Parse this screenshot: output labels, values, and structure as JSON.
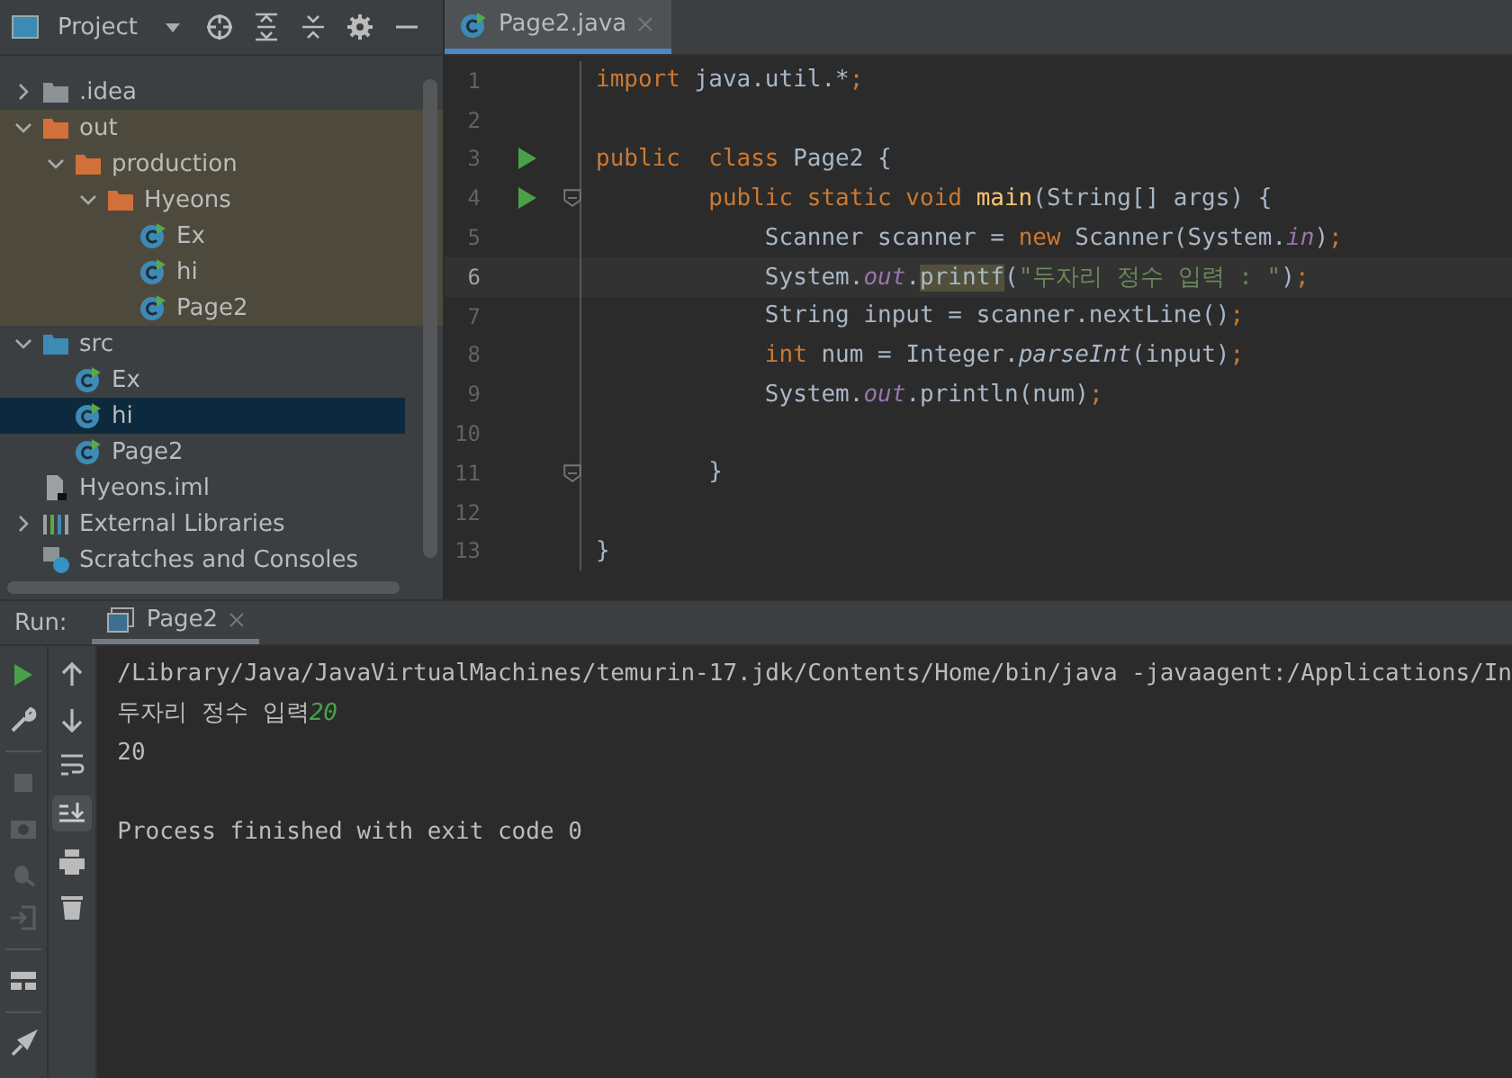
{
  "project_toolbar": {
    "title": "Project"
  },
  "tree": [
    {
      "label": ".idea",
      "kind": "folder",
      "expanded": false,
      "selected": false,
      "excluded": false
    },
    {
      "label": "out",
      "kind": "folder",
      "expanded": true,
      "selected": false,
      "excluded": true,
      "children": [
        {
          "label": "production",
          "kind": "folder",
          "expanded": true,
          "selected": false,
          "children": [
            {
              "label": "Hyeons",
              "kind": "folder",
              "expanded": true,
              "selected": false,
              "children": [
                {
                  "label": "Ex",
                  "kind": "class",
                  "selected": false
                },
                {
                  "label": "hi",
                  "kind": "class",
                  "selected": false
                },
                {
                  "label": "Page2",
                  "kind": "class",
                  "selected": false
                }
              ]
            }
          ]
        }
      ]
    },
    {
      "label": "src",
      "kind": "source",
      "expanded": true,
      "selected": false,
      "excluded": false,
      "children": [
        {
          "label": "Ex",
          "kind": "class",
          "selected": false
        },
        {
          "label": "hi",
          "kind": "class",
          "selected": true
        },
        {
          "label": "Page2",
          "kind": "class",
          "selected": false
        }
      ]
    },
    {
      "label": "Hyeons.iml",
      "kind": "file",
      "selected": false,
      "excluded": false
    },
    {
      "label": "External Libraries",
      "kind": "library",
      "expanded": false,
      "selected": false,
      "excluded": false
    },
    {
      "label": "Scratches and Consoles",
      "kind": "scratch",
      "selected": false,
      "excluded": false
    }
  ],
  "editor_tabs": [
    {
      "label": "Page2.java",
      "selected": true
    }
  ],
  "code": [
    {
      "number": "1",
      "run": false,
      "fold": false,
      "current": false,
      "tokens": [
        {
          "kind": "keyword",
          "text": "import"
        },
        {
          "kind": "plain",
          "text": " java.util.*"
        },
        {
          "kind": "keyword",
          "text": ";"
        }
      ]
    },
    {
      "number": "2",
      "run": false,
      "fold": false,
      "current": false
    },
    {
      "number": "3",
      "run": true,
      "fold": false,
      "current": false,
      "tokens": [
        {
          "kind": "keyword",
          "text": "public  class"
        },
        {
          "kind": "plain",
          "text": " Page2 {"
        }
      ]
    },
    {
      "number": "4",
      "run": true,
      "fold": true,
      "current": false,
      "tokens": [
        {
          "kind": "keyword",
          "text": "        public static void"
        },
        {
          "kind": "method",
          "text": " main"
        },
        {
          "kind": "plain",
          "text": "(String[] args) {"
        }
      ]
    },
    {
      "number": "5",
      "run": false,
      "fold": false,
      "current": false,
      "tokens": [
        {
          "kind": "plain",
          "text": "            Scanner scanner = "
        },
        {
          "kind": "keyword",
          "text": "new"
        },
        {
          "kind": "plain",
          "text": " Scanner(System."
        },
        {
          "kind": "field",
          "text": "in"
        },
        {
          "kind": "plain",
          "text": ")"
        },
        {
          "kind": "keyword",
          "text": ";"
        }
      ]
    },
    {
      "number": "6",
      "run": false,
      "fold": false,
      "current": true,
      "tokens": [
        {
          "kind": "plain",
          "text": "            System."
        },
        {
          "kind": "field",
          "text": "out"
        },
        {
          "kind": "plain",
          "text": "."
        },
        {
          "kind": "highlight",
          "text": "printf"
        },
        {
          "kind": "plain",
          "text": "("
        },
        {
          "kind": "string",
          "text": "\"두자리 정수 입력 : \""
        },
        {
          "kind": "plain",
          "text": ")"
        },
        {
          "kind": "keyword",
          "text": ";"
        }
      ]
    },
    {
      "number": "7",
      "run": false,
      "fold": false,
      "current": false,
      "tokens": [
        {
          "kind": "plain",
          "text": "            String input = scanner.nextLine()"
        },
        {
          "kind": "keyword",
          "text": ";"
        }
      ]
    },
    {
      "number": "8",
      "run": false,
      "fold": false,
      "current": false,
      "tokens": [
        {
          "kind": "keyword",
          "text": "            int"
        },
        {
          "kind": "plain",
          "text": " num = Integer."
        },
        {
          "kind": "static",
          "text": "parseInt"
        },
        {
          "kind": "plain",
          "text": "(input)"
        },
        {
          "kind": "keyword",
          "text": ";"
        }
      ]
    },
    {
      "number": "9",
      "run": false,
      "fold": false,
      "current": false,
      "tokens": [
        {
          "kind": "plain",
          "text": "            System."
        },
        {
          "kind": "field",
          "text": "out"
        },
        {
          "kind": "plain",
          "text": ".println(num)"
        },
        {
          "kind": "keyword",
          "text": ";"
        }
      ]
    },
    {
      "number": "10",
      "run": false,
      "fold": false,
      "current": false
    },
    {
      "number": "11",
      "run": false,
      "fold": true,
      "current": false,
      "tokens": [
        {
          "kind": "plain",
          "text": "        }"
        }
      ]
    },
    {
      "number": "12",
      "run": false,
      "fold": false,
      "current": false
    },
    {
      "number": "13",
      "run": false,
      "fold": false,
      "current": false,
      "tokens": [
        {
          "kind": "plain",
          "text": "}"
        }
      ]
    }
  ],
  "run_panel": {
    "label": "Run:",
    "tabs": [
      {
        "label": "Page2",
        "selected": true
      }
    ]
  },
  "console": [
    {
      "blank_before": false,
      "segments": [
        {
          "kind": "output",
          "text": "/Library/Java/JavaVirtualMachines/temurin-17.jdk/Contents/Home/bin/java -javaagent:/Applications/In"
        }
      ]
    },
    {
      "blank_before": false,
      "segments": [
        {
          "kind": "output",
          "text": "두자리 정수 입력"
        },
        {
          "kind": "input",
          "text": "20"
        }
      ]
    },
    {
      "blank_before": false,
      "segments": [
        {
          "kind": "output",
          "text": "20"
        }
      ]
    },
    {
      "blank_before": true,
      "segments": [
        {
          "kind": "output",
          "text": "Process finished with exit code 0"
        }
      ]
    }
  ]
}
